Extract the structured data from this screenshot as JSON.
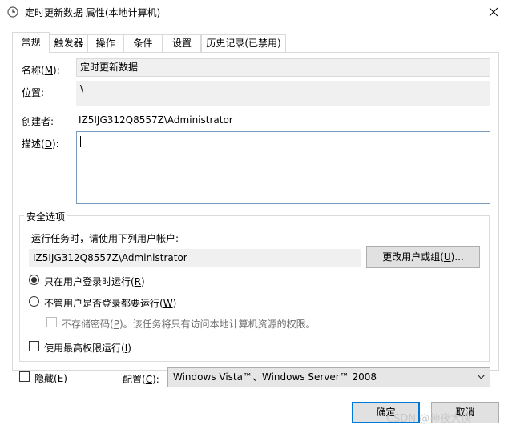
{
  "window": {
    "title": "定时更新数据 属性(本地计算机)",
    "icon": "clock-icon",
    "close": "close-icon"
  },
  "tabs": [
    {
      "label": "常规",
      "active": true
    },
    {
      "label": "触发器"
    },
    {
      "label": "操作"
    },
    {
      "label": "条件"
    },
    {
      "label": "设置"
    },
    {
      "label": "历史记录(已禁用)"
    }
  ],
  "general": {
    "name_label": "名称(",
    "name_key": "M",
    "name_end": "):",
    "name_value": "定时更新数据",
    "location_label": "位置:",
    "location_value": "\\",
    "author_label": "创建者:",
    "author_value": "IZ5IJG312Q8557Z\\Administrator",
    "desc_label": "描述(",
    "desc_key": "D",
    "desc_end": "):",
    "desc_value": ""
  },
  "security": {
    "group_title": "安全选项",
    "run_as_label": "运行任务时，请使用下列用户帐户:",
    "user_value": "IZ5IJG312Q8557Z\\Administrator",
    "change_user_pre": "更改用户或组(",
    "change_user_key": "U",
    "change_user_post": ")...",
    "radio_logged_on_pre": "只在用户登录时运行(",
    "radio_logged_on_key": "R",
    "radio_logged_on_post": ")",
    "radio_logged_on_checked": true,
    "radio_any_pre": "不管用户是否登录都要运行(",
    "radio_any_key": "W",
    "radio_any_post": ")",
    "no_store_pre": "不存储密码(",
    "no_store_key": "P",
    "no_store_post": ")。该任务将只有访问本地计算机资源的权限。",
    "highest_pre": "使用最高权限运行(",
    "highest_key": "I",
    "highest_post": ")"
  },
  "bottom": {
    "hidden_pre": "隐藏(",
    "hidden_key": "E",
    "hidden_post": ")",
    "config_pre": "配置(",
    "config_key": "C",
    "config_post": "):",
    "config_value": "Windows Vista™、Windows Server™ 2008"
  },
  "buttons": {
    "ok": "确定",
    "cancel": "取消"
  },
  "watermark": "CSDN @神夜大侠",
  "colors": {
    "accent": "#0078d7",
    "field_bg": "#f0f0f0",
    "button_bg": "#e1e1e1"
  }
}
